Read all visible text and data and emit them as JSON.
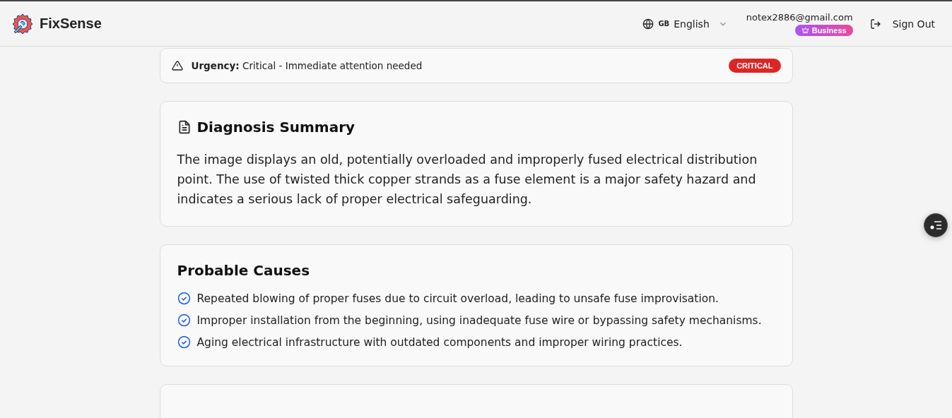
{
  "header": {
    "brand": "FixSense",
    "language": {
      "flag": "GB",
      "label": "English"
    },
    "email": "notex2886@gmail.com",
    "plan": "Business",
    "sign_out": "Sign Out"
  },
  "urgency": {
    "text": "**Urgency:** Critical - Immediate attention needed",
    "badge": "CRITICAL"
  },
  "summary": {
    "title": "Diagnosis Summary",
    "text": "The image displays an old, potentially overloaded and improperly fused electrical distribution point. The use of twisted thick copper strands as a fuse element is a major safety hazard and indicates a serious lack of proper electrical safeguarding."
  },
  "causes": {
    "title": "Probable Causes",
    "items": [
      "Repeated blowing of proper fuses due to circuit overload, leading to unsafe fuse improvisation.",
      "Improper installation from the beginning, using inadequate fuse wire or bypassing safety mechanisms.",
      "Aging electrical infrastructure with outdated components and improper wiring practices."
    ]
  }
}
